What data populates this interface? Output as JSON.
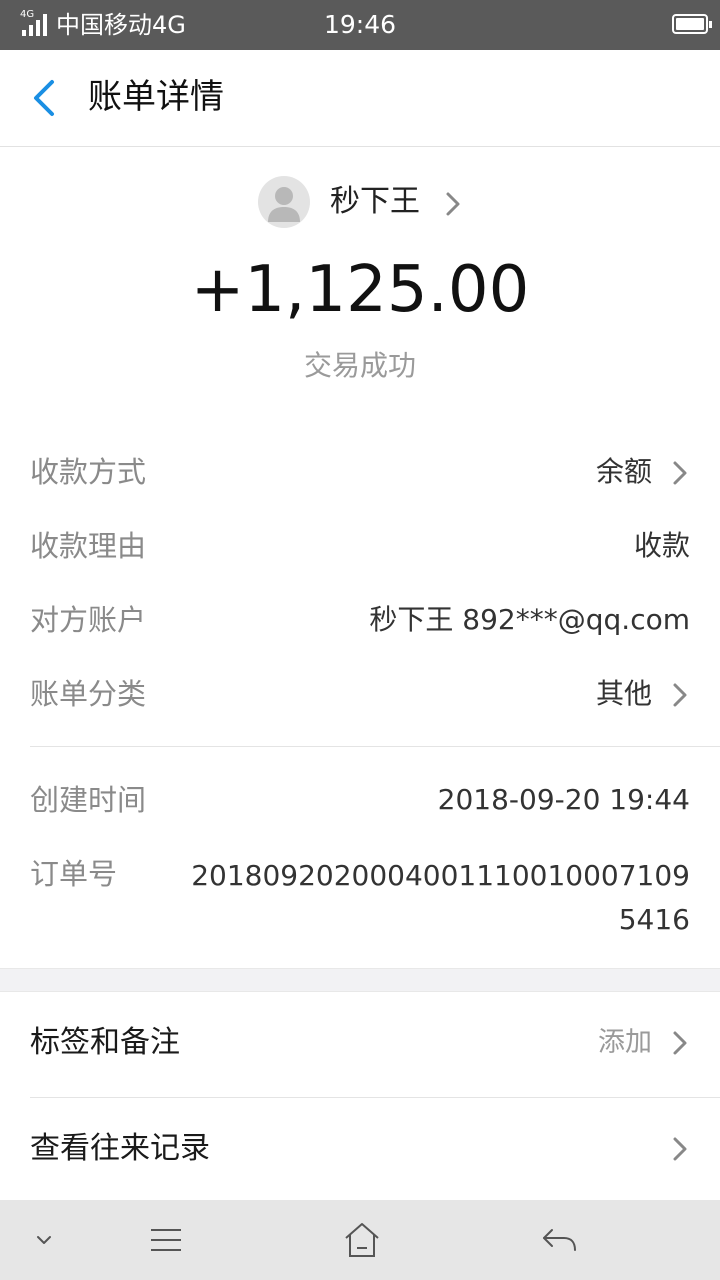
{
  "status_bar": {
    "network_tag": "4G",
    "carrier": "中国移动4G",
    "time": "19:46"
  },
  "header": {
    "title": "账单详情",
    "back_icon": "back-chevron-icon"
  },
  "payer": {
    "avatar_icon": "default-avatar-icon",
    "name": "秒下王"
  },
  "amount": "+1,125.00",
  "trade_status": "交易成功",
  "details": [
    {
      "label": "收款方式",
      "value": "余额"
    },
    {
      "label": "收款理由",
      "value": "收款"
    },
    {
      "label": "对方账户",
      "value": "秒下王 892***@qq.com"
    },
    {
      "label": "账单分类",
      "value": "其他"
    }
  ],
  "meta": {
    "created_label": "创建时间",
    "created_value": "2018-09-20 19:44",
    "order_label": "订单号",
    "order_value": "2018092020004001110010007109 5416"
  },
  "actions": {
    "tags_label": "标签和备注",
    "tags_value": "添加",
    "history_label": "查看往来记录"
  },
  "colors": {
    "accent": "#1a8fe3",
    "status_bar": "#5a5a5a",
    "nav_bar": "#e6e6e6"
  }
}
